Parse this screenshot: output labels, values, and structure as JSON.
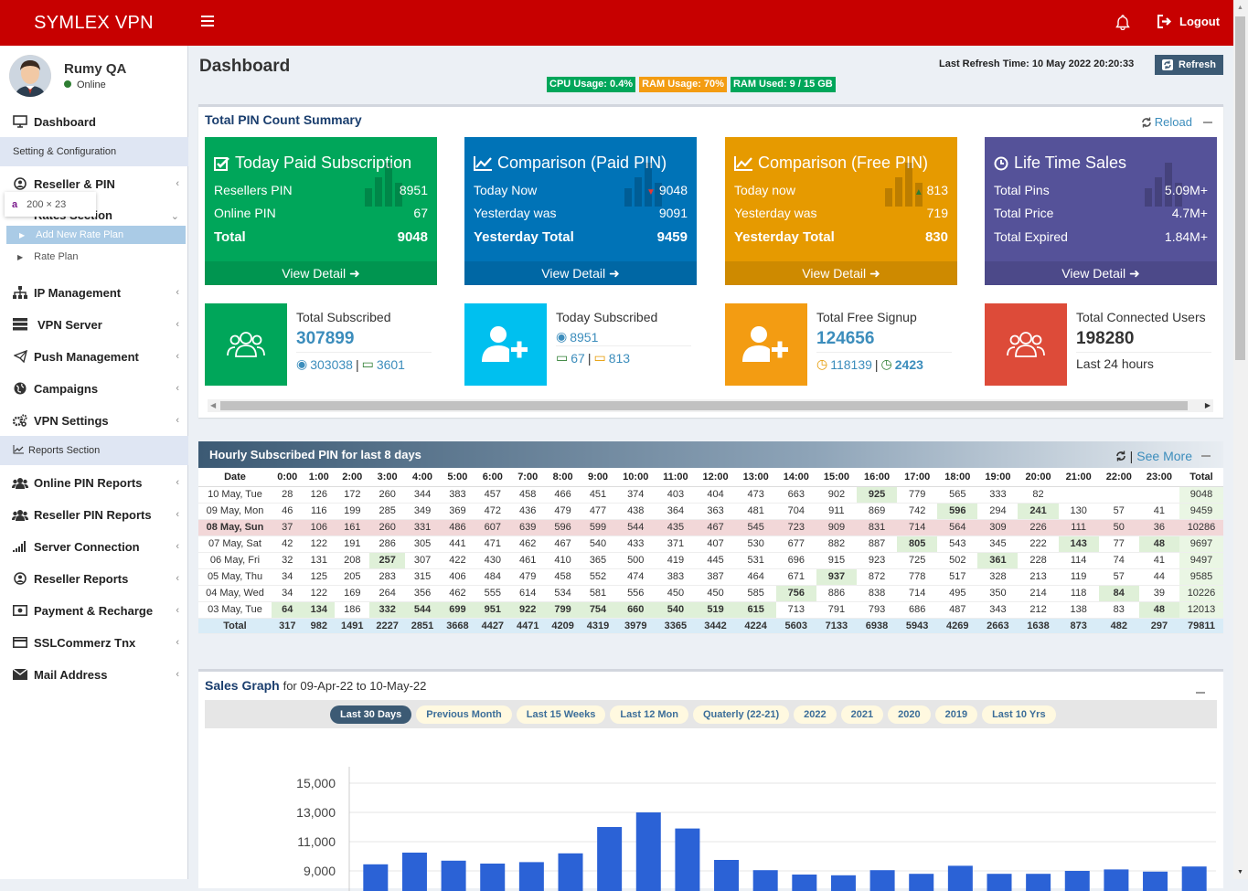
{
  "app": {
    "title": "SYMLEX VPN",
    "logout_label": "Logout"
  },
  "user": {
    "name": "Rumy QA",
    "status": "Online"
  },
  "tooltip": {
    "letter": "a",
    "text": "200 × 23"
  },
  "sidebar": {
    "dashboard": "Dashboard",
    "setting_header": "Setting & Configuration",
    "reseller_pin": "Reseller & PIN",
    "rates_section": "Rates Section",
    "add_rate_plan": "Add New Rate Plan",
    "rate_plan": "Rate Plan",
    "ip_management": "IP Management",
    "vpn_server": "VPN Server",
    "push_management": "Push Management",
    "campaigns": "Campaigns",
    "vpn_settings": "VPN Settings",
    "reports_header": "Reports Section",
    "online_pin_reports": "Online PIN Reports",
    "reseller_pin_reports": "Reseller PIN Reports",
    "server_connection": "Server Connection",
    "reseller_reports": "Reseller Reports",
    "payment_recharge": "Payment & Recharge",
    "sslcommerz": "SSLCommerz Tnx",
    "mail_address": "Mail Address"
  },
  "header": {
    "page_title": "Dashboard",
    "refresh_time": "Last Refresh Time: 10 May 2022 20:20:33",
    "refresh_label": "Refresh",
    "cpu": "CPU Usage: 0.4%",
    "ram": "RAM Usage: 70%",
    "ram_used": "RAM Used: 9 / 15 GB"
  },
  "colors": {
    "brand": "#c70000",
    "green": "#00a65a",
    "blue": "#0073b7",
    "orange": "#e69a00",
    "purple": "#555299",
    "aqua": "#00c0ef",
    "red": "#dd4b39",
    "cpu": "#00a65a",
    "ram": "#f39c12"
  },
  "summary": {
    "title": "Total PIN Count Summary",
    "reload": "Reload",
    "view_detail": "View Detail",
    "cards": [
      {
        "title": "Today Paid Subscription",
        "r1l": "Resellers PIN",
        "r1v": "8951",
        "r2l": "Online PIN",
        "r2v": "67",
        "r3l": "Total",
        "r3v": "9048"
      },
      {
        "title": "Comparison (Paid PIN)",
        "r1l": "Today Now",
        "r1v": "9048",
        "r2l": "Yesterday was",
        "r2v": "9091",
        "r3l": "Yesterday Total",
        "r3v": "9459"
      },
      {
        "title": "Comparison (Free PIN)",
        "r1l": "Today now",
        "r1v": "813",
        "r2l": "Yesterday was",
        "r2v": "719",
        "r3l": "Yesterday Total",
        "r3v": "830"
      },
      {
        "title": "Life Time Sales",
        "r1l": "Total Pins",
        "r1v": "5.09M+",
        "r2l": "Total Price",
        "r2v": "4.7M+",
        "r3l": "Total Expired",
        "r3v": "1.84M+"
      }
    ],
    "info": [
      {
        "label": "Total Subscribed",
        "value": "307899",
        "a": "303038",
        "b": "3601"
      },
      {
        "label": "Today Subscribed",
        "a": "8951",
        "b": "67",
        "c": "813"
      },
      {
        "label": "Total Free Signup",
        "value": "124656",
        "a": "118139",
        "b": "2423"
      },
      {
        "label": "Total Connected Users",
        "value": "198280",
        "sub": "Last 24 hours"
      }
    ]
  },
  "hourly": {
    "title": "Hourly Subscribed PIN for last 8 days",
    "see_more": "See More",
    "headers": [
      "Date",
      "0:00",
      "1:00",
      "2:00",
      "3:00",
      "4:00",
      "5:00",
      "6:00",
      "7:00",
      "8:00",
      "9:00",
      "10:00",
      "11:00",
      "12:00",
      "13:00",
      "14:00",
      "15:00",
      "16:00",
      "17:00",
      "18:00",
      "19:00",
      "20:00",
      "21:00",
      "22:00",
      "23:00",
      "Total"
    ],
    "rows": [
      {
        "cells": [
          "10 May, Tue",
          "28",
          "126",
          "172",
          "260",
          "344",
          "383",
          "457",
          "458",
          "466",
          "451",
          "374",
          "403",
          "404",
          "473",
          "663",
          "902",
          "925",
          "779",
          "565",
          "333",
          "82",
          "",
          "",
          "",
          "9048"
        ],
        "hl": [
          16
        ]
      },
      {
        "cells": [
          "09 May, Mon",
          "46",
          "116",
          "199",
          "285",
          "349",
          "369",
          "472",
          "436",
          "479",
          "477",
          "438",
          "364",
          "363",
          "481",
          "704",
          "911",
          "869",
          "742",
          "596",
          "294",
          "241",
          "130",
          "57",
          "41",
          "9459"
        ],
        "hl": [
          18,
          20
        ]
      },
      {
        "cells": [
          "08 May, Sun",
          "37",
          "106",
          "161",
          "260",
          "331",
          "486",
          "607",
          "639",
          "596",
          "599",
          "544",
          "435",
          "467",
          "545",
          "723",
          "909",
          "831",
          "714",
          "564",
          "309",
          "226",
          "111",
          "50",
          "36",
          "10286"
        ],
        "hl": [],
        "sun": true
      },
      {
        "cells": [
          "07 May, Sat",
          "42",
          "122",
          "191",
          "286",
          "305",
          "441",
          "471",
          "462",
          "467",
          "540",
          "433",
          "371",
          "407",
          "530",
          "677",
          "882",
          "887",
          "805",
          "543",
          "345",
          "222",
          "143",
          "77",
          "48",
          "9697"
        ],
        "hl": [
          17,
          21,
          23
        ]
      },
      {
        "cells": [
          "06 May, Fri",
          "32",
          "131",
          "208",
          "257",
          "307",
          "422",
          "430",
          "461",
          "410",
          "365",
          "500",
          "419",
          "445",
          "531",
          "696",
          "915",
          "923",
          "725",
          "502",
          "361",
          "228",
          "114",
          "74",
          "41",
          "9497"
        ],
        "hl": [
          3,
          19
        ]
      },
      {
        "cells": [
          "05 May, Thu",
          "34",
          "125",
          "205",
          "283",
          "315",
          "406",
          "484",
          "479",
          "458",
          "552",
          "474",
          "383",
          "387",
          "464",
          "671",
          "937",
          "872",
          "778",
          "517",
          "328",
          "213",
          "119",
          "57",
          "44",
          "9585"
        ],
        "hl": [
          15
        ]
      },
      {
        "cells": [
          "04 May, Wed",
          "34",
          "122",
          "169",
          "264",
          "356",
          "462",
          "555",
          "614",
          "534",
          "581",
          "556",
          "450",
          "450",
          "585",
          "756",
          "886",
          "838",
          "714",
          "495",
          "350",
          "214",
          "118",
          "84",
          "39",
          "10226"
        ],
        "hl": [
          14,
          22
        ]
      },
      {
        "cells": [
          "03 May, Tue",
          "64",
          "134",
          "186",
          "332",
          "544",
          "699",
          "951",
          "922",
          "799",
          "754",
          "660",
          "540",
          "519",
          "615",
          "713",
          "791",
          "793",
          "686",
          "487",
          "343",
          "212",
          "138",
          "83",
          "48",
          "12013"
        ],
        "hl": [
          0,
          1,
          3,
          4,
          5,
          6,
          7,
          8,
          9,
          10,
          11,
          12,
          13,
          23
        ]
      }
    ],
    "totals": [
      "Total",
      "317",
      "982",
      "1491",
      "2227",
      "2851",
      "3668",
      "4427",
      "4471",
      "4209",
      "4319",
      "3979",
      "3365",
      "3442",
      "4224",
      "5603",
      "7133",
      "6938",
      "5943",
      "4269",
      "2663",
      "1638",
      "873",
      "482",
      "297",
      "79811"
    ]
  },
  "sales": {
    "title": "Sales Graph",
    "range": "for 09-Apr-22 to 10-May-22",
    "tabs": [
      "Last 30 Days",
      "Previous Month",
      "Last 15 Weeks",
      "Last 12 Mon",
      "Quaterly (22-21)",
      "2022",
      "2021",
      "2020",
      "2019",
      "Last 10 Yrs"
    ],
    "active_tab": 0
  },
  "chart_data": {
    "type": "bar",
    "title": "",
    "xlabel": "",
    "ylabel": "",
    "y_ticks": [
      "9,000",
      "11,000",
      "13,000",
      "15,000"
    ],
    "ylim": [
      8000,
      15800
    ],
    "values": [
      9450,
      10250,
      9700,
      9500,
      9600,
      10200,
      12000,
      13000,
      11900,
      9750,
      9050,
      8750,
      8700,
      9050,
      8800,
      9350,
      8800,
      8800,
      9000,
      9100,
      8950,
      9300
    ],
    "color": "#2b62d6",
    "grid": true
  }
}
